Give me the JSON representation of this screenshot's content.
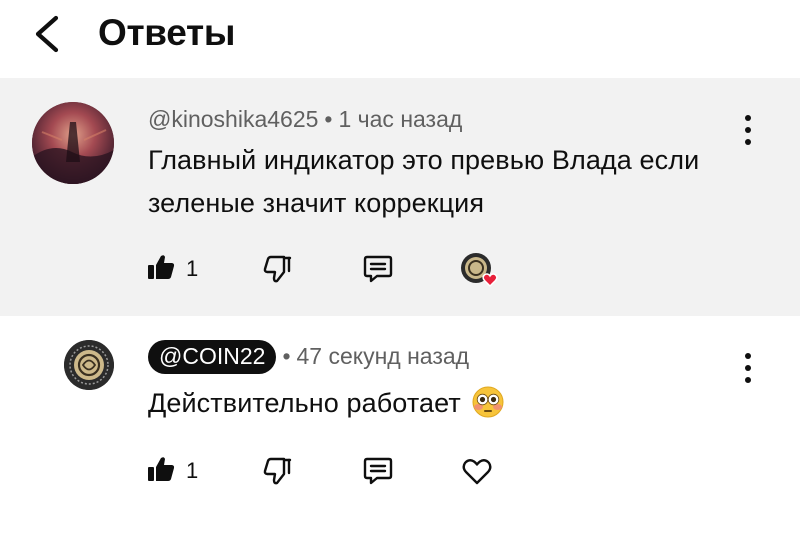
{
  "header": {
    "back_icon": "chevron-left-icon",
    "title": "Ответы"
  },
  "parent_comment": {
    "author": "@kinoshika4625",
    "separator": "•",
    "time": "1 час назад",
    "text_lines": [
      "Главный индикатор это превью Влада если",
      "зеленые значит коррекция"
    ],
    "likes": "1",
    "background": "#f2f2f2",
    "creator_heart": true
  },
  "reply_comment": {
    "author": "@COIN22",
    "separator": "•",
    "time": "47 секунд назад",
    "text": "Действительно работает",
    "emoji": "😳",
    "likes": "1"
  },
  "colors": {
    "text": "#0f0f0f",
    "meta": "#606060",
    "heart": "#e8203a",
    "pill": "#0f0f0f"
  }
}
